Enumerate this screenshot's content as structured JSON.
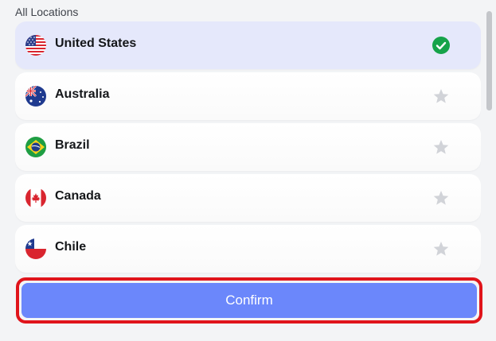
{
  "section_label": "All Locations",
  "locations": [
    {
      "name": "United States",
      "flag": "us-flag",
      "status": "selected-check-icon",
      "selected": true
    },
    {
      "name": "Australia",
      "flag": "au-flag",
      "status": "star-icon",
      "selected": false
    },
    {
      "name": "Brazil",
      "flag": "br-flag",
      "status": "star-icon",
      "selected": false
    },
    {
      "name": "Canada",
      "flag": "ca-flag",
      "status": "star-icon",
      "selected": false
    },
    {
      "name": "Chile",
      "flag": "cl-flag",
      "status": "star-icon",
      "selected": false
    }
  ],
  "confirm_label": "Confirm",
  "colors": {
    "accent": "#6b87fb",
    "selected_row": "#e5e8fb",
    "check_green": "#16a34a",
    "star_gray": "#d1d3d8",
    "highlight_border": "#e0141b"
  }
}
